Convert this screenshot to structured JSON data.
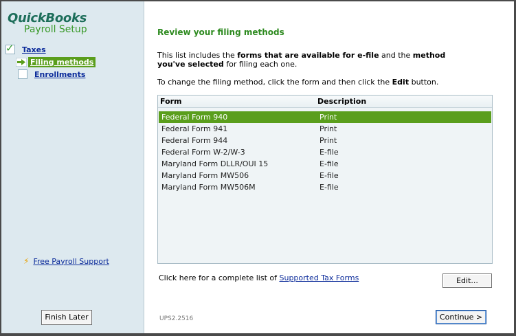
{
  "sidebar": {
    "brand_line1": "QuickBooks",
    "brand_line2": "Payroll Setup",
    "items": [
      {
        "label": "Taxes",
        "state": "checked"
      },
      {
        "label": "Filing methods",
        "state": "current"
      },
      {
        "label": "Enrollments",
        "state": "unchecked"
      }
    ],
    "support_label": "Free Payroll Support",
    "finish_later_label": "Finish Later"
  },
  "main": {
    "title": "Review your filing methods",
    "intro_parts": {
      "p1": "This list includes the ",
      "b1": "forms that are available for e-file",
      "p2": " and the ",
      "b2": "method you've selected",
      "p3": " for filing each one."
    },
    "instruction_parts": {
      "p1": "To change the filing method, click the form and then click the ",
      "b1": "Edit",
      "p2": " button."
    },
    "columns": {
      "form": "Form",
      "description": "Description"
    },
    "rows": [
      {
        "form": "Federal Form 940",
        "description": "Print",
        "selected": true
      },
      {
        "form": "Federal Form 941",
        "description": "Print",
        "selected": false
      },
      {
        "form": "Federal Form 944",
        "description": "Print",
        "selected": false
      },
      {
        "form": "Federal Form W-2/W-3",
        "description": "E-file",
        "selected": false
      },
      {
        "form": "Maryland Form DLLR/OUI 15",
        "description": "E-file",
        "selected": false
      },
      {
        "form": "Maryland Form MW506",
        "description": "E-file",
        "selected": false
      },
      {
        "form": "Maryland Form MW506M",
        "description": "E-file",
        "selected": false
      }
    ],
    "footer_text": "Click here for a complete list of ",
    "footer_link": "Supported Tax Forms",
    "edit_label": "Edit...",
    "version": "UPS2.2516",
    "continue_label": "Continue >"
  },
  "colors": {
    "accent_green": "#5a9e1c",
    "title_green": "#2d8a1f",
    "link_blue": "#0a2a9a"
  }
}
